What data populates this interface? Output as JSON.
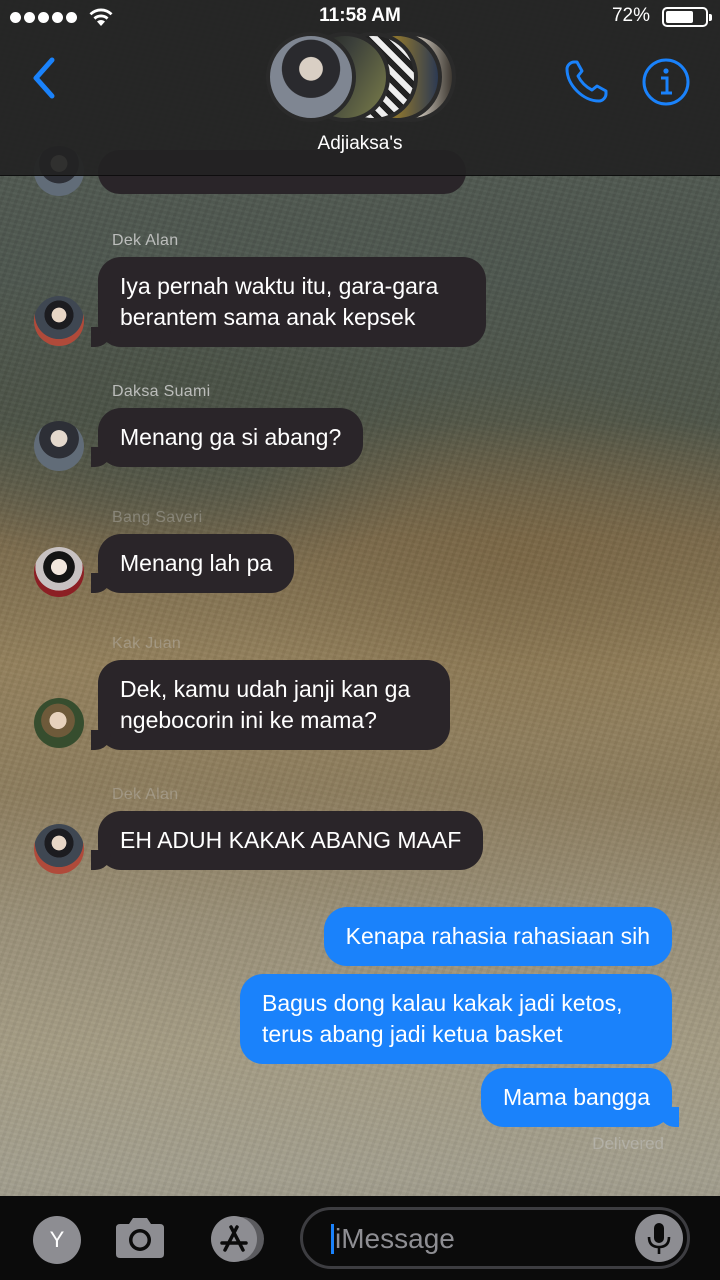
{
  "status_bar": {
    "time": "11:58 AM",
    "battery_percent": "72%",
    "battery_level": 0.72,
    "signal_bars": 5
  },
  "header": {
    "title": "Adjiaksa's",
    "back_icon": "chevron-left-icon",
    "call_icon": "phone-icon",
    "info_icon": "info-icon",
    "accent_color": "#1a82fb"
  },
  "messages": [
    {
      "sender": "Dek Alan",
      "text": "Iya pernah waktu itu, gara-gara berantem sama anak kepsek",
      "direction": "incoming"
    },
    {
      "sender": "Daksa Suami",
      "text": "Menang ga si abang?",
      "direction": "incoming"
    },
    {
      "sender": "Bang Saveri",
      "text": "Menang lah pa",
      "direction": "incoming"
    },
    {
      "sender": "Kak Juan",
      "text": "Dek, kamu udah janji kan ga ngebocorin ini ke mama?",
      "direction": "incoming"
    },
    {
      "sender": "Dek Alan",
      "text": "EH ADUH KAKAK ABANG MAAF",
      "direction": "incoming"
    },
    {
      "text": "Kenapa rahasia rahasiaan sih",
      "direction": "outgoing"
    },
    {
      "text": "Bagus dong kalau kakak jadi ketos, terus abang jadi ketua basket",
      "direction": "outgoing"
    },
    {
      "text": "Mama bangga",
      "direction": "outgoing"
    }
  ],
  "delivery_status": "Delivered",
  "composer": {
    "profile_initial": "Y",
    "placeholder": "iMessage",
    "camera_icon": "camera-icon",
    "apps_icon": "app-store-icon",
    "mic_icon": "microphone-icon"
  },
  "colors": {
    "incoming_bubble": "#2a2529",
    "outgoing_bubble": "#1a82fb"
  }
}
